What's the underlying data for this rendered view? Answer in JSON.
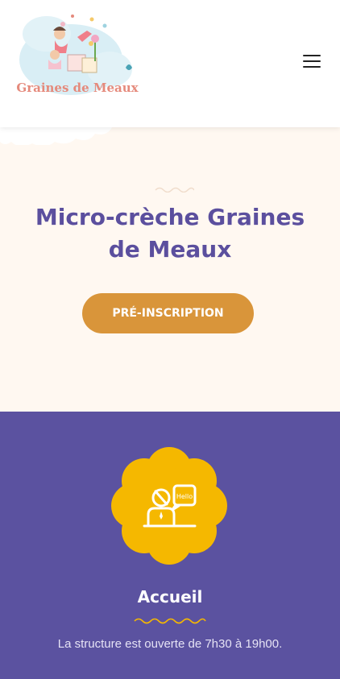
{
  "header": {
    "logo_text": "Graines de Meaux",
    "menu_icon": "hamburger-menu-icon"
  },
  "hero": {
    "title": "Micro-crèche Graines de Meaux",
    "cta_label": "PRÉ-INSCRIPTION"
  },
  "accueil": {
    "icon": "reception-hello-icon",
    "icon_text": "Hello",
    "title": "Accueil",
    "text": "La structure est ouverte de 7h30 à 19h00."
  },
  "colors": {
    "purple": "#5b52a0",
    "title_purple": "#5b4f9e",
    "orange": "#d9953a",
    "yellow": "#f5b800",
    "hero_bg": "#fff8f1"
  }
}
